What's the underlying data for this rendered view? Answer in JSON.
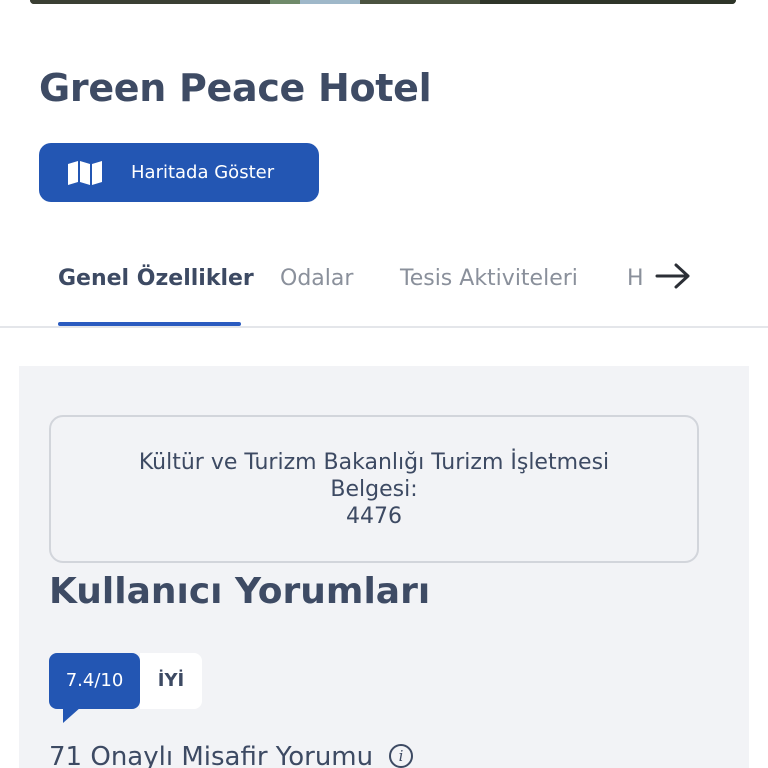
{
  "hotel": {
    "name": "Green Peace Hotel"
  },
  "map_button": {
    "label": "Haritada Göster",
    "icon": "map-icon",
    "color": "#2356b3"
  },
  "tabs": {
    "items": [
      {
        "label": "Genel Özellikler",
        "active": true
      },
      {
        "label": "Odalar",
        "active": false
      },
      {
        "label": "Tesis Aktiviteleri",
        "active": false
      },
      {
        "label": "H",
        "active": false
      }
    ],
    "next_icon": "arrow-right-icon",
    "accent": "#2a5bc0"
  },
  "license": {
    "line1": "Kültür ve Turizm Bakanlığı Turizm İşletmesi",
    "line2": "Belgesi:",
    "number": "4476"
  },
  "reviews": {
    "title": "Kullanıcı Yorumları",
    "score": "7.4/10",
    "rating_word": "İYİ",
    "count_text": "71 Onaylı Misafir Yorumu",
    "info_icon": "info-icon"
  }
}
